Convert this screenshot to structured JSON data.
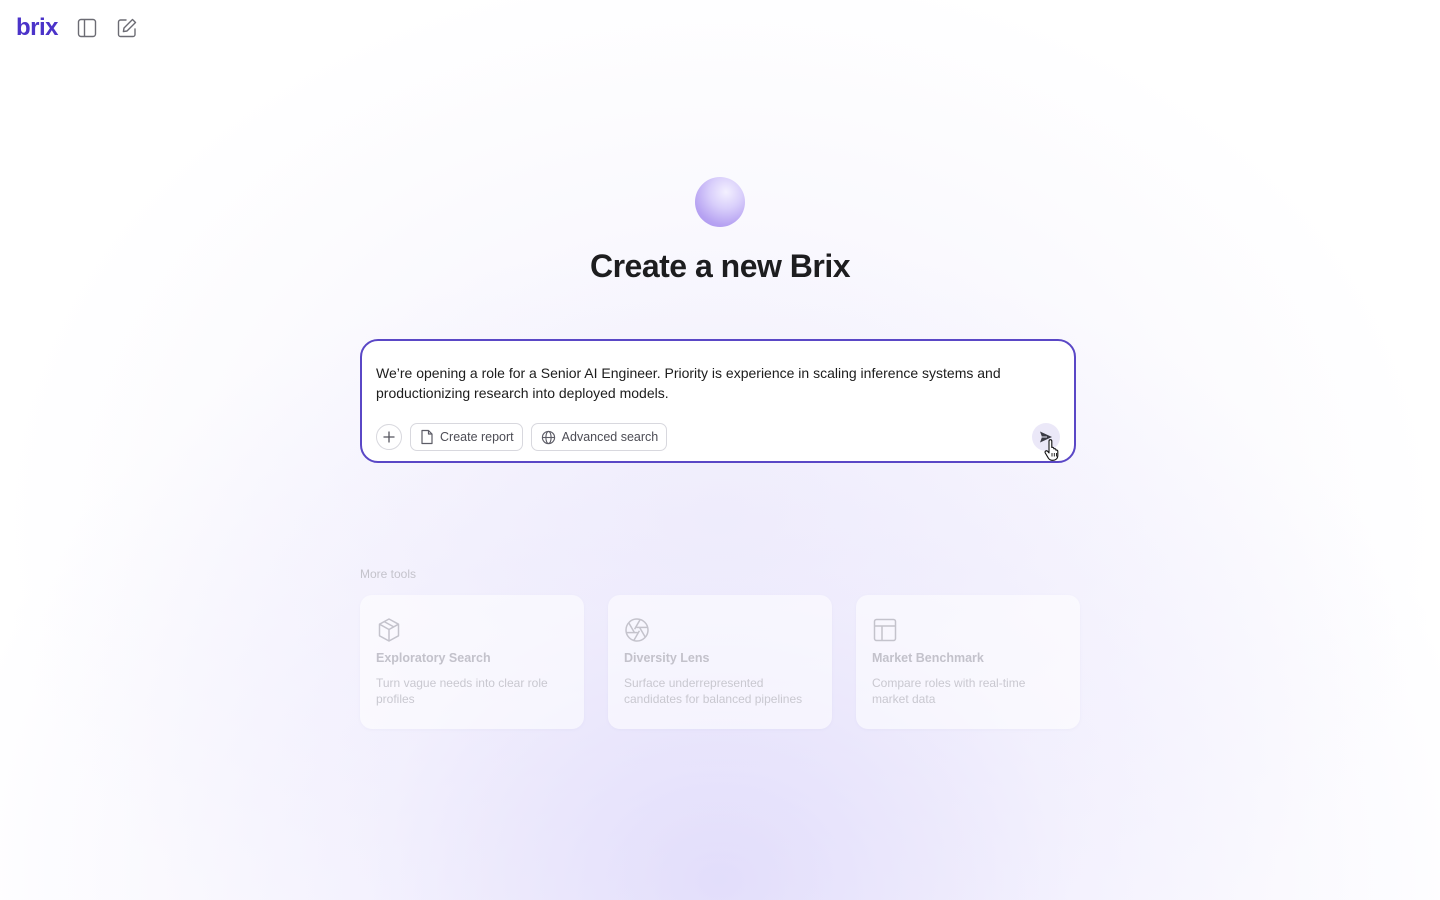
{
  "app": {
    "logo_text": "brix",
    "brand_color": "#4b33c9",
    "accent_border_color": "#5a47c6"
  },
  "topbar": {
    "icons": [
      "sidebar-toggle-icon",
      "new-chat-edit-icon"
    ]
  },
  "hero": {
    "title": "Create a new Brix"
  },
  "composer": {
    "text": "We’re opening a role for a Senior AI Engineer. Priority is experience in scaling inference systems and productionizing research into deployed models.",
    "add_icon": "plus-icon",
    "chips": [
      {
        "label": "Create report",
        "icon": "document-icon"
      },
      {
        "label": "Advanced search",
        "icon": "globe-icon"
      }
    ],
    "send_icon": "send-icon"
  },
  "more_tools": {
    "label": "More tools",
    "cards": [
      {
        "title": "Exploratory Search",
        "description": "Turn vague needs into clear role profiles",
        "icon": "cube-icon"
      },
      {
        "title": "Diversity Lens",
        "description": "Surface underrepresented candidates for balanced pipelines",
        "icon": "aperture-icon"
      },
      {
        "title": "Market Benchmark",
        "description": "Compare roles with real-time market data",
        "icon": "layout-panel-icon"
      }
    ]
  }
}
